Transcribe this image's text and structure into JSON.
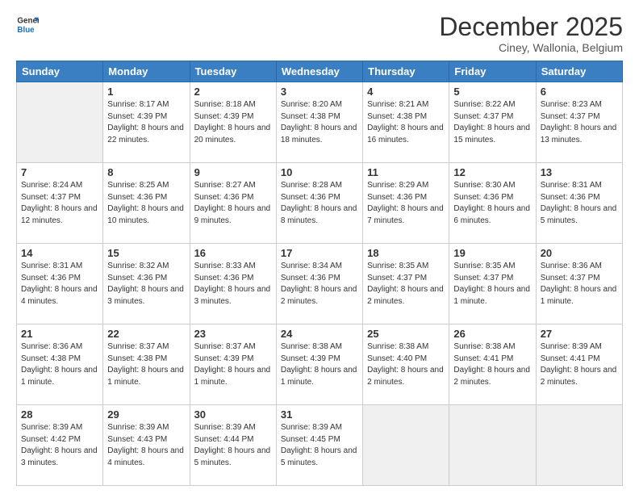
{
  "logo": {
    "line1": "General",
    "line2": "Blue"
  },
  "title": "December 2025",
  "subtitle": "Ciney, Wallonia, Belgium",
  "days_of_week": [
    "Sunday",
    "Monday",
    "Tuesday",
    "Wednesday",
    "Thursday",
    "Friday",
    "Saturday"
  ],
  "weeks": [
    [
      {
        "num": "",
        "sunrise": "",
        "sunset": "",
        "daylight": ""
      },
      {
        "num": "1",
        "sunrise": "8:17 AM",
        "sunset": "4:39 PM",
        "daylight": "8 hours and 22 minutes."
      },
      {
        "num": "2",
        "sunrise": "8:18 AM",
        "sunset": "4:39 PM",
        "daylight": "8 hours and 20 minutes."
      },
      {
        "num": "3",
        "sunrise": "8:20 AM",
        "sunset": "4:38 PM",
        "daylight": "8 hours and 18 minutes."
      },
      {
        "num": "4",
        "sunrise": "8:21 AM",
        "sunset": "4:38 PM",
        "daylight": "8 hours and 16 minutes."
      },
      {
        "num": "5",
        "sunrise": "8:22 AM",
        "sunset": "4:37 PM",
        "daylight": "8 hours and 15 minutes."
      },
      {
        "num": "6",
        "sunrise": "8:23 AM",
        "sunset": "4:37 PM",
        "daylight": "8 hours and 13 minutes."
      }
    ],
    [
      {
        "num": "7",
        "sunrise": "8:24 AM",
        "sunset": "4:37 PM",
        "daylight": "8 hours and 12 minutes."
      },
      {
        "num": "8",
        "sunrise": "8:25 AM",
        "sunset": "4:36 PM",
        "daylight": "8 hours and 10 minutes."
      },
      {
        "num": "9",
        "sunrise": "8:27 AM",
        "sunset": "4:36 PM",
        "daylight": "8 hours and 9 minutes."
      },
      {
        "num": "10",
        "sunrise": "8:28 AM",
        "sunset": "4:36 PM",
        "daylight": "8 hours and 8 minutes."
      },
      {
        "num": "11",
        "sunrise": "8:29 AM",
        "sunset": "4:36 PM",
        "daylight": "8 hours and 7 minutes."
      },
      {
        "num": "12",
        "sunrise": "8:30 AM",
        "sunset": "4:36 PM",
        "daylight": "8 hours and 6 minutes."
      },
      {
        "num": "13",
        "sunrise": "8:31 AM",
        "sunset": "4:36 PM",
        "daylight": "8 hours and 5 minutes."
      }
    ],
    [
      {
        "num": "14",
        "sunrise": "8:31 AM",
        "sunset": "4:36 PM",
        "daylight": "8 hours and 4 minutes."
      },
      {
        "num": "15",
        "sunrise": "8:32 AM",
        "sunset": "4:36 PM",
        "daylight": "8 hours and 3 minutes."
      },
      {
        "num": "16",
        "sunrise": "8:33 AM",
        "sunset": "4:36 PM",
        "daylight": "8 hours and 3 minutes."
      },
      {
        "num": "17",
        "sunrise": "8:34 AM",
        "sunset": "4:36 PM",
        "daylight": "8 hours and 2 minutes."
      },
      {
        "num": "18",
        "sunrise": "8:35 AM",
        "sunset": "4:37 PM",
        "daylight": "8 hours and 2 minutes."
      },
      {
        "num": "19",
        "sunrise": "8:35 AM",
        "sunset": "4:37 PM",
        "daylight": "8 hours and 1 minute."
      },
      {
        "num": "20",
        "sunrise": "8:36 AM",
        "sunset": "4:37 PM",
        "daylight": "8 hours and 1 minute."
      }
    ],
    [
      {
        "num": "21",
        "sunrise": "8:36 AM",
        "sunset": "4:38 PM",
        "daylight": "8 hours and 1 minute."
      },
      {
        "num": "22",
        "sunrise": "8:37 AM",
        "sunset": "4:38 PM",
        "daylight": "8 hours and 1 minute."
      },
      {
        "num": "23",
        "sunrise": "8:37 AM",
        "sunset": "4:39 PM",
        "daylight": "8 hours and 1 minute."
      },
      {
        "num": "24",
        "sunrise": "8:38 AM",
        "sunset": "4:39 PM",
        "daylight": "8 hours and 1 minute."
      },
      {
        "num": "25",
        "sunrise": "8:38 AM",
        "sunset": "4:40 PM",
        "daylight": "8 hours and 2 minutes."
      },
      {
        "num": "26",
        "sunrise": "8:38 AM",
        "sunset": "4:41 PM",
        "daylight": "8 hours and 2 minutes."
      },
      {
        "num": "27",
        "sunrise": "8:39 AM",
        "sunset": "4:41 PM",
        "daylight": "8 hours and 2 minutes."
      }
    ],
    [
      {
        "num": "28",
        "sunrise": "8:39 AM",
        "sunset": "4:42 PM",
        "daylight": "8 hours and 3 minutes."
      },
      {
        "num": "29",
        "sunrise": "8:39 AM",
        "sunset": "4:43 PM",
        "daylight": "8 hours and 4 minutes."
      },
      {
        "num": "30",
        "sunrise": "8:39 AM",
        "sunset": "4:44 PM",
        "daylight": "8 hours and 5 minutes."
      },
      {
        "num": "31",
        "sunrise": "8:39 AM",
        "sunset": "4:45 PM",
        "daylight": "8 hours and 5 minutes."
      },
      {
        "num": "",
        "sunrise": "",
        "sunset": "",
        "daylight": ""
      },
      {
        "num": "",
        "sunrise": "",
        "sunset": "",
        "daylight": ""
      },
      {
        "num": "",
        "sunrise": "",
        "sunset": "",
        "daylight": ""
      }
    ]
  ]
}
